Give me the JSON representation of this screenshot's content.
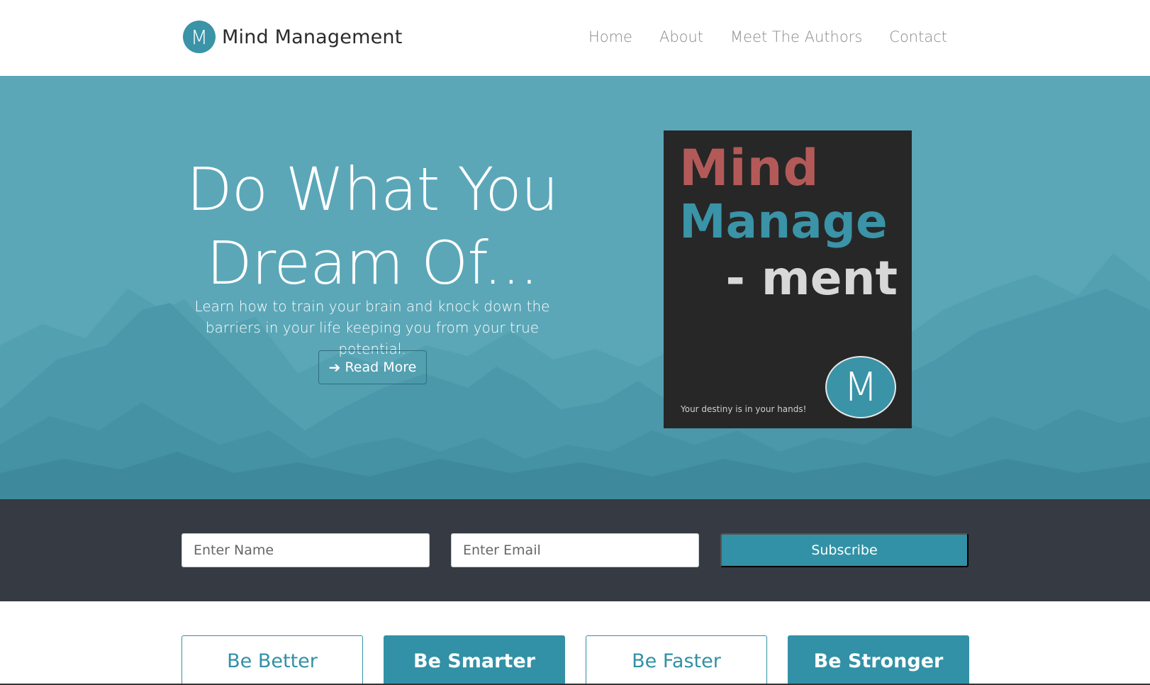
{
  "brand": {
    "logo_letter": "M",
    "name": "Mind Management"
  },
  "nav": {
    "items": [
      "Home",
      "About",
      "Meet The Authors",
      "Contact"
    ]
  },
  "hero": {
    "title_line1": "Do What You",
    "title_line2": "Dream Of...",
    "subtitle": "Learn how to train your brain and knock down the barriers in your life keeping you from your true potential.",
    "read_more": "Read More"
  },
  "book": {
    "line1": "Mind",
    "line2": "Manage",
    "line3": "- ment",
    "tagline": "Your destiny is in your hands!",
    "logo_letter": "M"
  },
  "subscribe": {
    "name_placeholder": "Enter Name",
    "email_placeholder": "Enter Email",
    "button": "Subscribe"
  },
  "boxes": [
    "Be Better",
    "Be Smarter",
    "Be Faster",
    "Be Stronger"
  ],
  "colors": {
    "accent": "#3291a6",
    "hero_bg": "#5ba7b8",
    "dark_band": "#353a43",
    "book_bg": "#272727",
    "book_red": "#b35a59"
  }
}
